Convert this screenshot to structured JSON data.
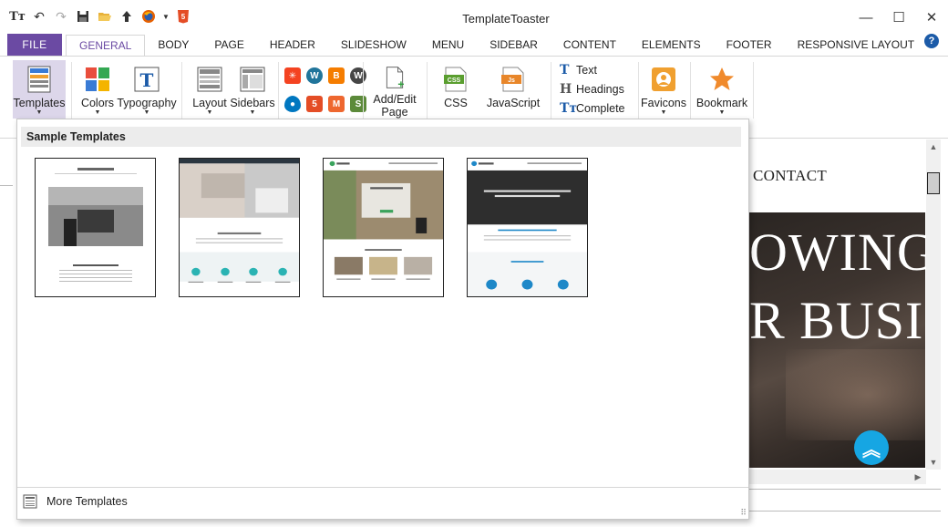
{
  "window": {
    "title": "TemplateToaster"
  },
  "qat": [
    "logo-icon",
    "undo-icon",
    "redo-icon",
    "save-icon",
    "open-icon",
    "upload-icon",
    "firefox-icon",
    "dropdown-icon",
    "html5-icon"
  ],
  "tabs": {
    "file": "FILE",
    "items": [
      "GENERAL",
      "BODY",
      "PAGE",
      "HEADER",
      "SLIDESHOW",
      "MENU",
      "SIDEBAR",
      "CONTENT",
      "ELEMENTS",
      "FOOTER",
      "RESPONSIVE LAYOUT"
    ],
    "active": "GENERAL"
  },
  "ribbon": {
    "templates": "Templates",
    "colors": "Colors",
    "typography": "Typography",
    "layout": "Layout",
    "sidebars": "Sidebars",
    "add_edit_page": "Add/Edit Page",
    "css": "CSS",
    "javascript": "JavaScript",
    "text": "Text",
    "headings": "Headings",
    "complete": "Complete",
    "favicons": "Favicons",
    "bookmark": "Bookmark",
    "cms_icons": [
      "joomla-icon",
      "wordpress-icon",
      "blogger-icon",
      "wordpress-alt-icon",
      "drupal-icon",
      "html5-icon",
      "magento-icon",
      "shop-icon"
    ]
  },
  "panel": {
    "header": "Sample Templates",
    "footer": "More Templates",
    "templates": [
      {
        "name": "template-1",
        "bar_color": "#ffffff"
      },
      {
        "name": "template-2",
        "bar_color": "#2b3640"
      },
      {
        "name": "template-3",
        "bar_color": "#ffffff"
      },
      {
        "name": "template-4",
        "bar_color": "#ffffff"
      }
    ]
  },
  "preview": {
    "contact": "CONTACT",
    "hero_line1": "OWING A",
    "hero_line2": "R BUSIN"
  },
  "colors": {
    "accent": "#6b4aa3",
    "scroll_button": "#16a6e3",
    "help": "#1c5ba8"
  }
}
